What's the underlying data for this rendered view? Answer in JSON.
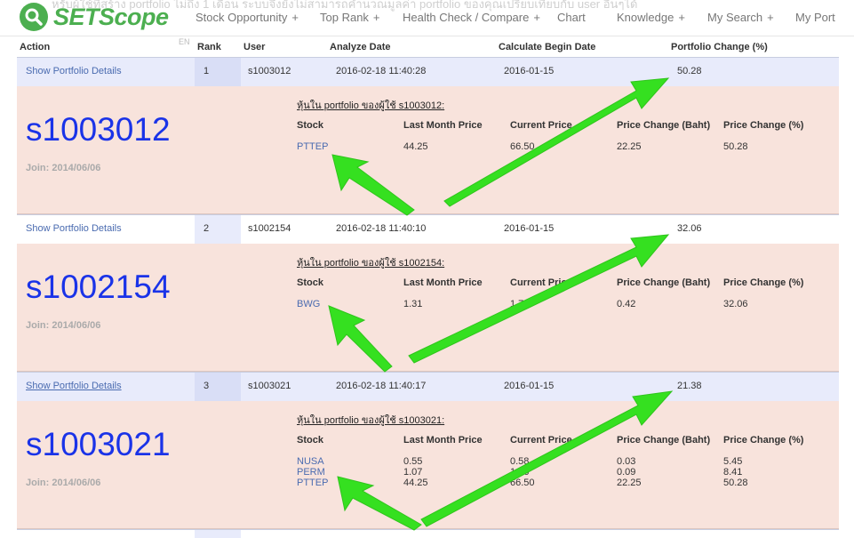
{
  "nav": {
    "ghost_text": "หรับผู้ใช้ที่สร้าง portfolio ไม่ถึง 1 เดือน ระบบจึงยังไม่สามารถคำนวณมูลค่า portfolio ของคุณเปรียบเทียบกับ user อื่นๆได้",
    "logo_text": "SETScope",
    "items": [
      {
        "label": "Stock Opportunity",
        "plus": "+"
      },
      {
        "label": "Top Rank",
        "plus": "+"
      },
      {
        "label": "Health Check / Compare",
        "plus": "+"
      },
      {
        "label": "Chart",
        "plus": ""
      },
      {
        "label": "Knowledge",
        "plus": "+"
      },
      {
        "label": "My Search",
        "plus": "+"
      },
      {
        "label": "My Port",
        "plus": ""
      }
    ],
    "lang": "EN"
  },
  "table": {
    "headers": [
      "Action",
      "Rank",
      "User",
      "Analyze Date",
      "Calculate Begin Date",
      "Portfolio Change (%)"
    ],
    "rows": [
      {
        "action": "Show Portfolio Details",
        "rank": "1",
        "user": "s1003012",
        "analyze_date": "2016-02-18 11:40:28",
        "begin_date": "2016-01-15",
        "change": "50.28",
        "detail": {
          "username": "s1003012",
          "join": "Join: 2014/06/06",
          "title": "หุ้นใน portfolio ของผู้ใช้ s1003012:",
          "headers": [
            "Stock",
            "Last Month Price",
            "Current Price",
            "Price Change (Baht)",
            "Price Change (%)"
          ],
          "stocks": [
            [
              "PTTEP",
              "44.25",
              "66.50",
              "22.25",
              "50.28"
            ]
          ]
        }
      },
      {
        "action": "Show Portfolio Details",
        "rank": "2",
        "user": "s1002154",
        "analyze_date": "2016-02-18 11:40:10",
        "begin_date": "2016-01-15",
        "change": "32.06",
        "detail": {
          "username": "s1002154",
          "join": "Join: 2014/06/06",
          "title": "หุ้นใน portfolio ของผู้ใช้ s1002154:",
          "headers": [
            "Stock",
            "Last Month Price",
            "Current Price",
            "Price Change (Baht)",
            "Price Change (%)"
          ],
          "stocks": [
            [
              "BWG",
              "1.31",
              "1.73",
              "0.42",
              "32.06"
            ]
          ]
        }
      },
      {
        "action": "Show Portfolio Details",
        "rank": "3",
        "user": "s1003021",
        "analyze_date": "2016-02-18 11:40:17",
        "begin_date": "2016-01-15",
        "change": "21.38",
        "detail": {
          "username": "s1003021",
          "join": "Join: 2014/06/06",
          "title": "หุ้นใน portfolio ของผู้ใช้ s1003021:",
          "headers": [
            "Stock",
            "Last Month Price",
            "Current Price",
            "Price Change (Baht)",
            "Price Change (%)"
          ],
          "stocks": [
            [
              "NUSA",
              "0.55",
              "0.58",
              "0.03",
              "5.45"
            ],
            [
              "PERM",
              "1.07",
              "1.16",
              "0.09",
              "8.41"
            ],
            [
              "PTTEP",
              "44.25",
              "66.50",
              "22.25",
              "50.28"
            ]
          ]
        }
      }
    ]
  },
  "colors": {
    "accent": "#4caf50",
    "link": "#4a6bb0",
    "username": "#1a33e8",
    "row_highlight": "#e8ebfb",
    "detail_bg": "#f8e3dc",
    "arrow": "#35e020"
  }
}
